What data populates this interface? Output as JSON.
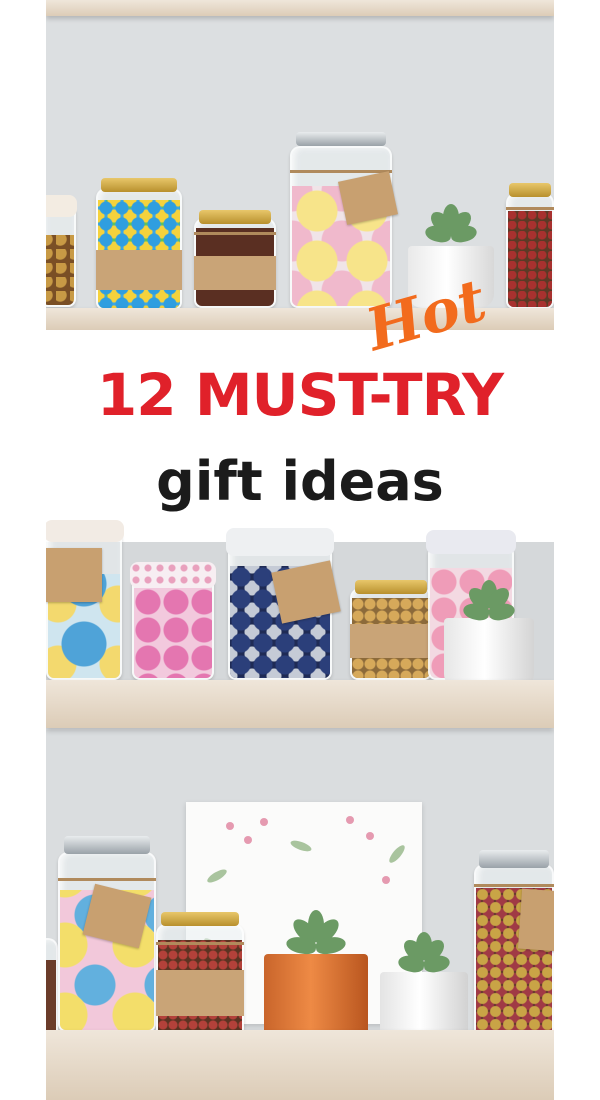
{
  "pin": {
    "badge": "Hot",
    "headline": "12 MUST-TRY",
    "subheadline": "gift ideas"
  },
  "colors": {
    "headline": "#e0212a",
    "badge": "#f26b1d",
    "subheadline": "#1b1b1b",
    "wall": "#dfe2e4",
    "shelf": "#e3d5c3"
  },
  "scene": {
    "shelves": 3,
    "items": [
      "candy-jar",
      "bath-bomb-jar",
      "tea-jar",
      "succulent-pot",
      "nut-jar",
      "framed-floral-print"
    ]
  }
}
